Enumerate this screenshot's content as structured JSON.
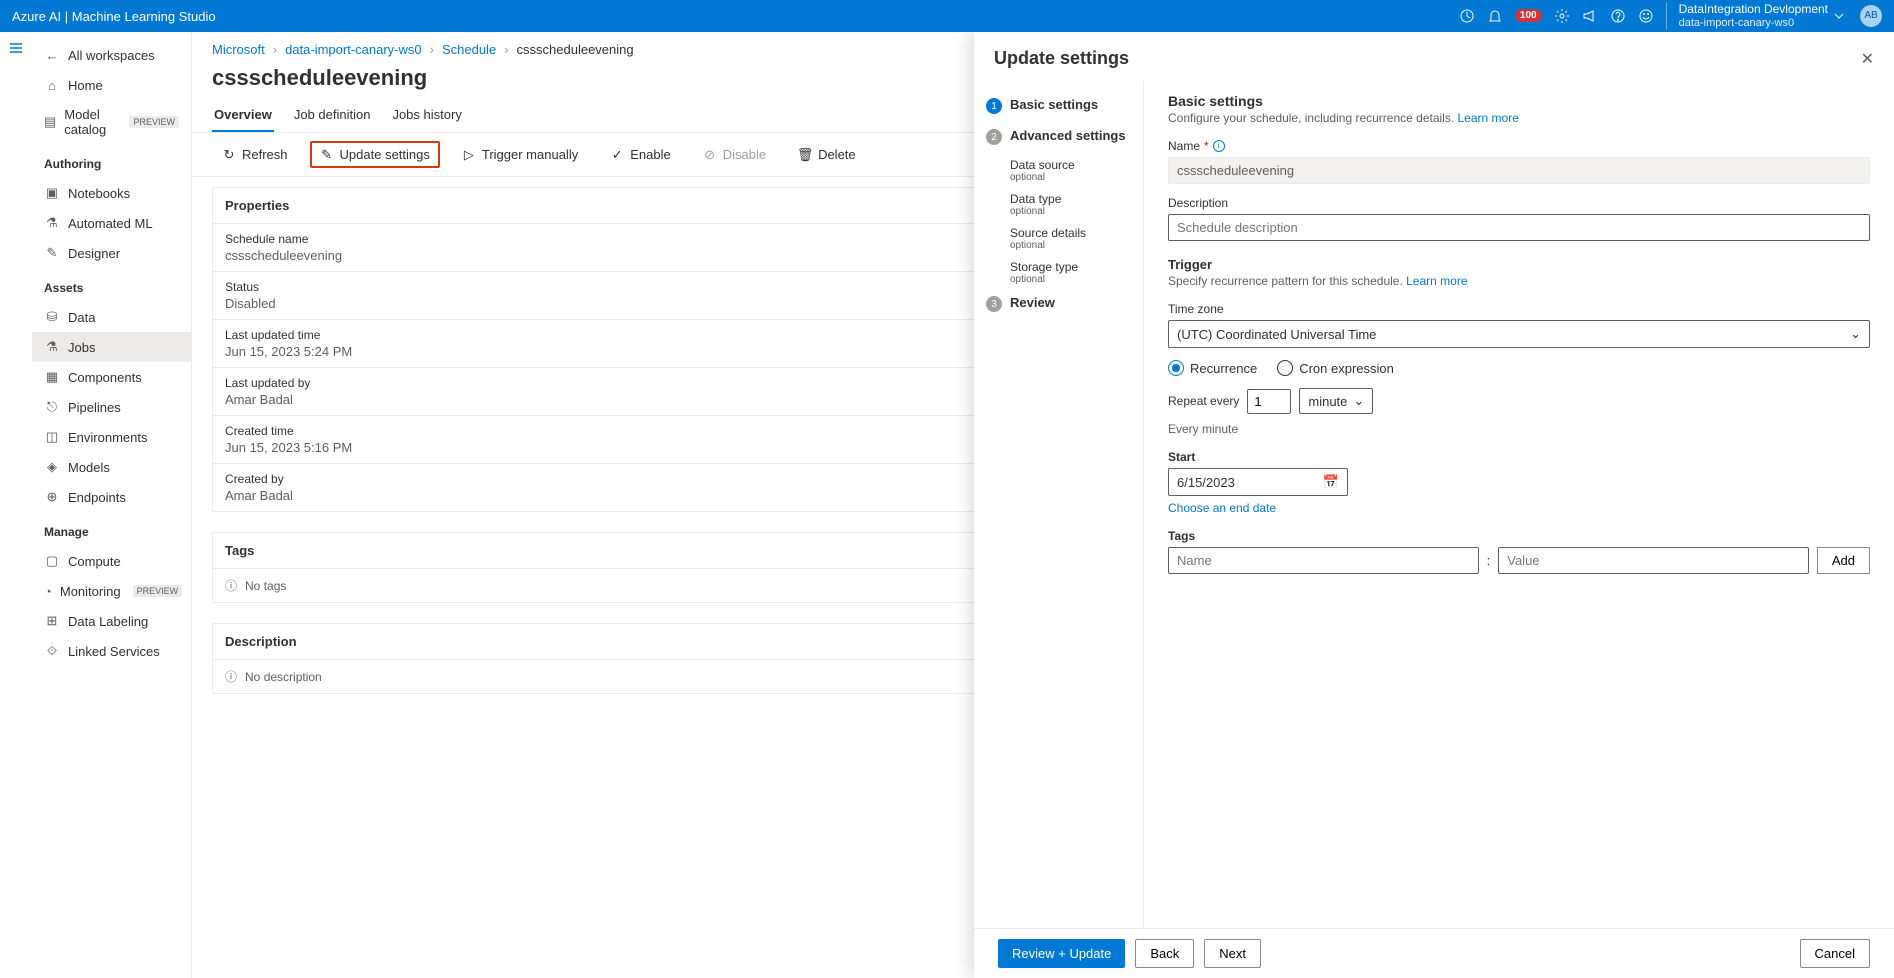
{
  "topbar": {
    "title": "Azure AI | Machine Learning Studio",
    "badge": "100",
    "tenant": "DataIntegration Devlopment",
    "workspace": "data-import-canary-ws0",
    "avatar": "AB"
  },
  "nav": {
    "all_workspaces": "All workspaces",
    "home": "Home",
    "model_catalog": "Model catalog",
    "preview": "PREVIEW",
    "authoring": "Authoring",
    "notebooks": "Notebooks",
    "automated_ml": "Automated ML",
    "designer": "Designer",
    "assets": "Assets",
    "data": "Data",
    "jobs": "Jobs",
    "components": "Components",
    "pipelines": "Pipelines",
    "environments": "Environments",
    "models": "Models",
    "endpoints": "Endpoints",
    "manage": "Manage",
    "compute": "Compute",
    "monitoring": "Monitoring",
    "data_labeling": "Data Labeling",
    "linked_services": "Linked Services"
  },
  "breadcrumb": {
    "b0": "Microsoft",
    "b1": "data-import-canary-ws0",
    "b2": "Schedule",
    "b3": "cssscheduleevening"
  },
  "page": {
    "title": "cssscheduleevening"
  },
  "tabs": {
    "overview": "Overview",
    "job_def": "Job definition",
    "jobs_history": "Jobs history"
  },
  "commands": {
    "refresh": "Refresh",
    "update": "Update settings",
    "trigger": "Trigger manually",
    "enable": "Enable",
    "disable": "Disable",
    "delete": "Delete"
  },
  "props": {
    "section": "Properties",
    "schedule_name_l": "Schedule name",
    "schedule_name_v": "cssscheduleevening",
    "status_l": "Status",
    "status_v": "Disabled",
    "lupdated_l": "Last updated time",
    "lupdated_v": "Jun 15, 2023 5:24 PM",
    "lupdatedby_l": "Last updated by",
    "lupdatedby_v": "Amar Badal",
    "created_l": "Created time",
    "created_v": "Jun 15, 2023 5:16 PM",
    "createdby_l": "Created by",
    "createdby_v": "Amar Badal",
    "tags_section": "Tags",
    "no_tags": "No tags",
    "desc_section": "Description",
    "no_desc": "No description"
  },
  "panel": {
    "title": "Update settings",
    "wiz": {
      "basic": "Basic settings",
      "advanced": "Advanced settings",
      "data_source": "Data source",
      "data_type": "Data type",
      "source_details": "Source details",
      "storage_type": "Storage type",
      "optional": "optional",
      "review": "Review"
    },
    "form": {
      "h_basic": "Basic settings",
      "d_basic": "Configure your schedule, including recurrence details. ",
      "learn_more": "Learn more",
      "name_l": "Name",
      "name_v": "cssscheduleevening",
      "desc_l": "Description",
      "desc_ph": "Schedule description",
      "trigger_h": "Trigger",
      "trigger_d": "Specify recurrence pattern for this schedule. ",
      "tz_l": "Time zone",
      "tz_v": "(UTC) Coordinated Universal Time",
      "recurrence": "Recurrence",
      "cron": "Cron expression",
      "repeat_l": "Repeat every",
      "repeat_n": "1",
      "repeat_u": "minute",
      "every_min": "Every minute",
      "start_l": "Start",
      "start_v": "6/15/2023",
      "choose_end": "Choose an end date",
      "tags_l": "Tags",
      "tag_name_ph": "Name",
      "tag_value_ph": "Value",
      "add": "Add"
    },
    "footer": {
      "review": "Review + Update",
      "back": "Back",
      "next": "Next",
      "cancel": "Cancel"
    }
  }
}
